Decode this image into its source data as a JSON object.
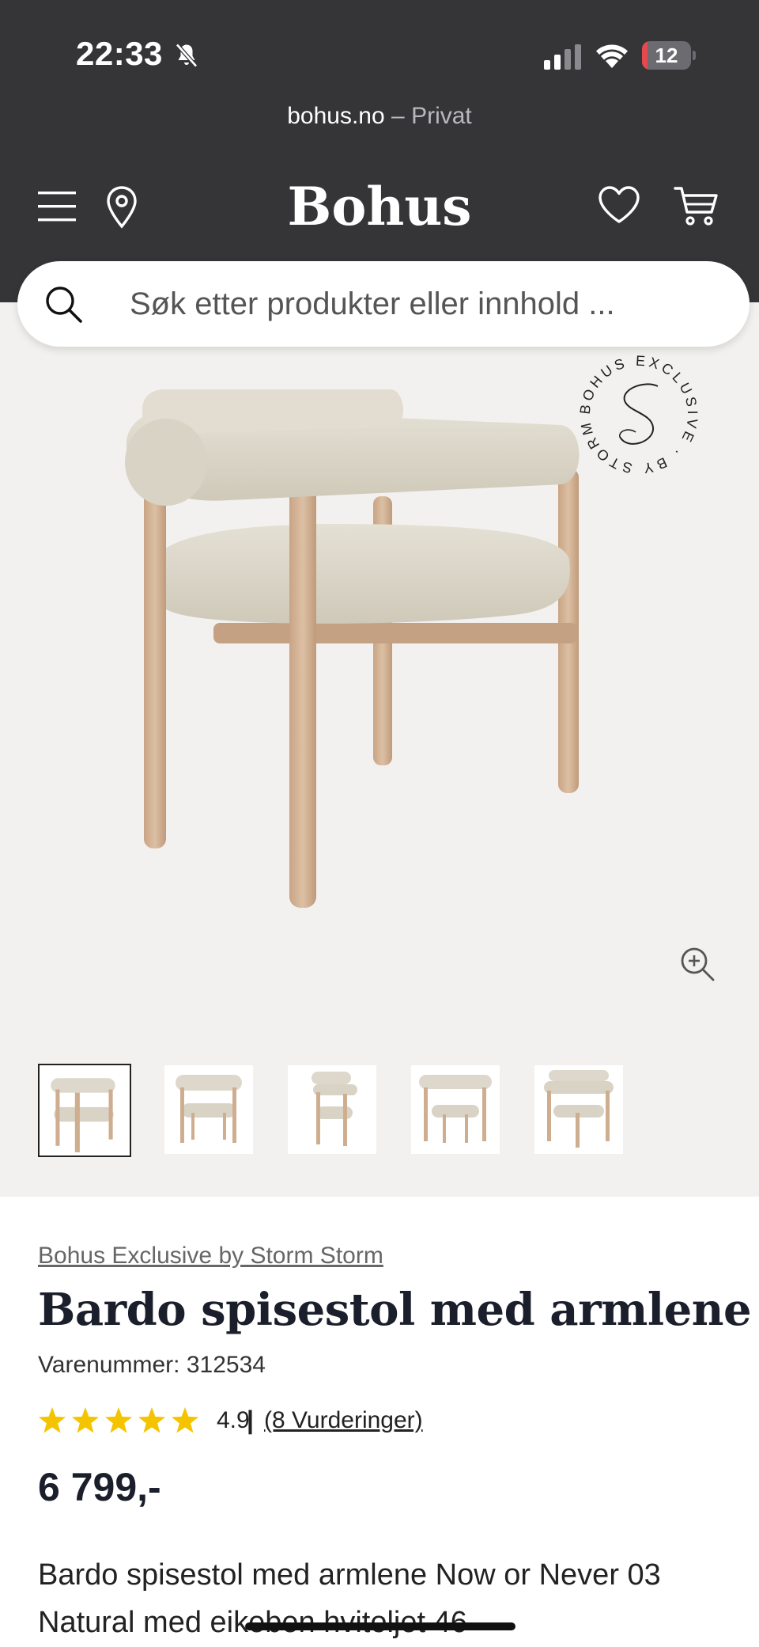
{
  "status_bar": {
    "time": "22:33",
    "battery_level": "12",
    "battery_fraction": 0.12
  },
  "browser": {
    "url": "bohus.no",
    "separator": "–",
    "mode": "Privat"
  },
  "header": {
    "logo": "Bohus",
    "icons": [
      "menu-icon",
      "location-icon",
      "heart-icon",
      "cart-icon"
    ]
  },
  "search": {
    "placeholder": "Søk etter produkter eller innhold ..."
  },
  "gallery": {
    "badge_text": "BOHUS EXCLUSIVE · BY STORM ·",
    "thumbnail_count": 5,
    "active_thumbnail": 1
  },
  "product": {
    "brand": "Bohus Exclusive by Storm Storm",
    "title": "Bardo spisestol med armlene",
    "sku_label": "Varenummer: 312534",
    "rating_value": "4.9",
    "rating_separator": "|",
    "rating_count": "(8 Vurderinger)",
    "stars": 5,
    "price": "6 799,-",
    "description": "Bardo spisestol med armlene Now or Never 03 Natural med eikeben hvitoljet 46"
  },
  "colors": {
    "header_bg": "#353538",
    "gallery_bg": "#f3f1ef",
    "star": "#f5c400",
    "battery_low": "#e5484d",
    "title": "#1a1f2b"
  }
}
